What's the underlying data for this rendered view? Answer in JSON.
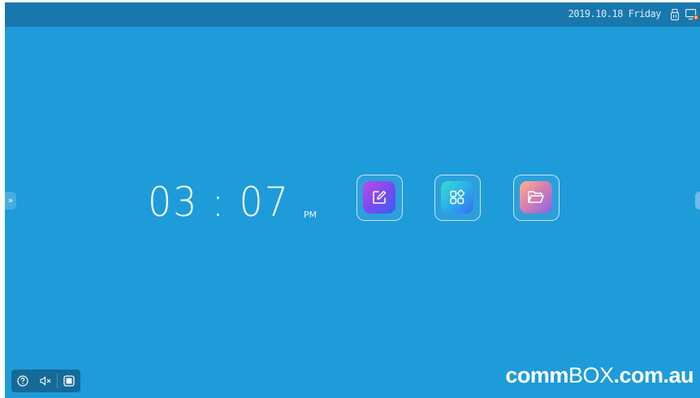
{
  "status_bar": {
    "date_label": "2019.10.18 Friday",
    "icons": [
      "usb-icon",
      "screen-share-icon"
    ]
  },
  "side_tabs": {
    "left_glyph": "»"
  },
  "clock": {
    "time": "03 : 07",
    "ampm": "PM"
  },
  "apps": [
    {
      "icon": "note-edit-icon"
    },
    {
      "icon": "apps-grid-icon"
    },
    {
      "icon": "folder-icon"
    }
  ],
  "toolbar": {
    "icons": [
      "help-icon",
      "mute-icon",
      "stop-square-icon"
    ]
  },
  "brand": {
    "part1": "comm",
    "part2": "BOX",
    "part3": ".com.au"
  },
  "colors": {
    "background": "#1e9bd9",
    "topbar": "#1878ad",
    "toolbar": "#166a98"
  }
}
